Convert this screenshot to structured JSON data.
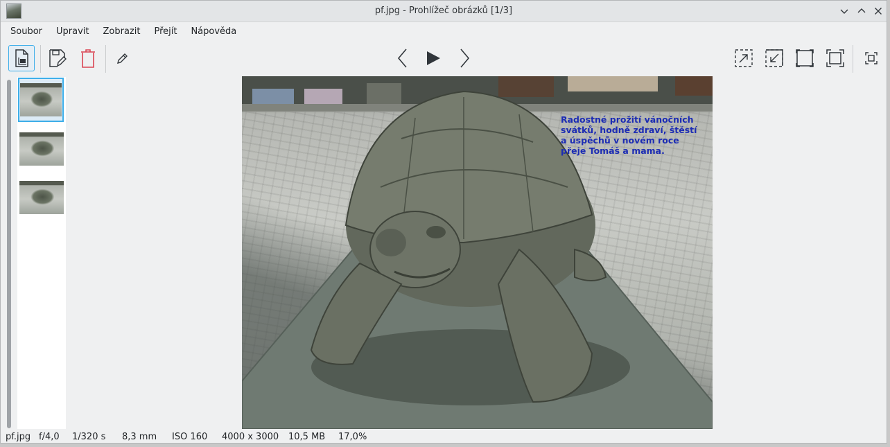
{
  "window": {
    "title": "pf.jpg - Prohlížeč obrázků [1/3]"
  },
  "menu": {
    "items": [
      "Soubor",
      "Upravit",
      "Zobrazit",
      "Přejít",
      "Nápověda"
    ]
  },
  "toolbar": {
    "left_icons": [
      "open-file-icon",
      "save-as-icon",
      "delete-icon",
      "edit-pencil-icon"
    ],
    "nav_icons": [
      "previous-icon",
      "play-slideshow-icon",
      "next-icon"
    ],
    "right_icons": [
      "zoom-in-icon",
      "zoom-out-icon",
      "fit-window-icon",
      "fit-width-icon",
      "fullscreen-icon"
    ]
  },
  "thumbnails": {
    "count": 3,
    "selected_index": 0
  },
  "photo": {
    "greeting_text": "Radostné prožití vánočních\nsvátků, hodně zdraví, štěstí\na úspěchů v novém roce\npřeje Tomáš a mama."
  },
  "status": {
    "filename": "pf.jpg",
    "aperture": "f/4,0",
    "exposure": "1/320 s",
    "focal_length": "8,3 mm",
    "iso": "ISO 160",
    "dimensions": "4000 x 3000",
    "file_size": "10,5 MB",
    "zoom": "17,0%"
  },
  "colors": {
    "accent": "#3daee9",
    "delete_red": "#da4453",
    "greeting_blue": "#1c2cb4"
  }
}
